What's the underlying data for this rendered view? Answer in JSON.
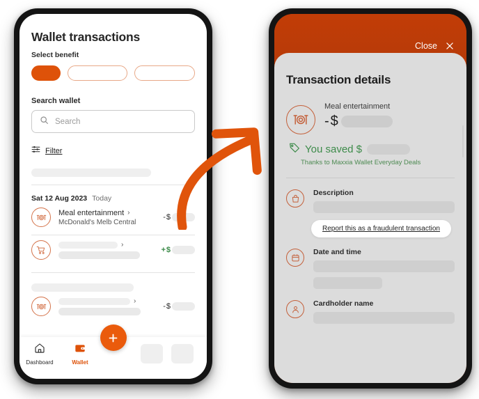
{
  "colors": {
    "brand_orange": "#de5209",
    "header_orange": "#c03d07",
    "fab_orange": "#ea5b0c",
    "icon_orange": "#c4603a",
    "green": "#3d8b4a",
    "sheet_gray": "#dcdcdc",
    "frame_black": "#141414",
    "arrow_orange": "#e0540b"
  },
  "left_phone": {
    "title": "Wallet transactions",
    "select_benefit_label": "Select benefit",
    "benefit_chips": [
      {
        "name": "benefit-chip-selected",
        "selected": true
      },
      {
        "name": "benefit-chip-2",
        "selected": false
      },
      {
        "name": "benefit-chip-3",
        "selected": false
      }
    ],
    "search_label": "Search wallet",
    "search_placeholder": "Search",
    "search_value": "",
    "search_icon": "search-icon",
    "filter": {
      "label": "Filter",
      "icon": "filter-sliders-icon"
    },
    "date_group": {
      "date": "Sat 12 Aug 2023",
      "relative": "Today"
    },
    "transactions": [
      {
        "icon": "meal-plate-icon",
        "name": "Meal entertainment",
        "merchant": "McDonald's Melb Central",
        "chevron": "›",
        "amount_sign": "-",
        "amount_currency": "$",
        "amount_masked": true,
        "amount_positive": false
      },
      {
        "icon": "shopping-cart-icon",
        "name": "",
        "merchant": "",
        "chevron": "›",
        "amount_sign": "+",
        "amount_currency": "$",
        "amount_masked": true,
        "amount_positive": true
      },
      {
        "icon": "meal-plate-icon",
        "name": "",
        "merchant": "",
        "chevron": "›",
        "amount_sign": "-",
        "amount_currency": "$",
        "amount_masked": true,
        "amount_positive": false
      }
    ],
    "bottom_nav": [
      {
        "icon": "home-icon",
        "label": "Dashboard",
        "active": false
      },
      {
        "icon": "wallet-icon",
        "label": "Wallet",
        "active": true
      }
    ],
    "fab": {
      "icon": "plus-icon",
      "label": "+"
    }
  },
  "right_phone": {
    "header": {
      "close_label": "Close",
      "close_icon": "close-x-icon"
    },
    "title": "Transaction details",
    "summary": {
      "icon": "meal-plate-icon",
      "category": "Meal entertainment",
      "amount_sign": "-",
      "amount_currency": "$",
      "amount_masked": true
    },
    "saved": {
      "icon": "tag-icon",
      "text": "You saved $",
      "amount_masked": true,
      "subtext": "Thanks to Maxxia Wallet Everyday Deals"
    },
    "fraud_link": "Report this as a fraudulent transaction",
    "sections": [
      {
        "icon": "bag-lock-icon",
        "label": "Description",
        "bars": [
          1
        ]
      },
      {
        "icon": "calendar-icon",
        "label": "Date and time",
        "bars": [
          1,
          0.5
        ]
      },
      {
        "icon": "person-icon",
        "label": "Cardholder name",
        "bars": [
          1
        ]
      }
    ]
  },
  "arrow": {
    "name": "flow-arrow",
    "description": "curved orange arrow pointing from left phone to right phone"
  }
}
